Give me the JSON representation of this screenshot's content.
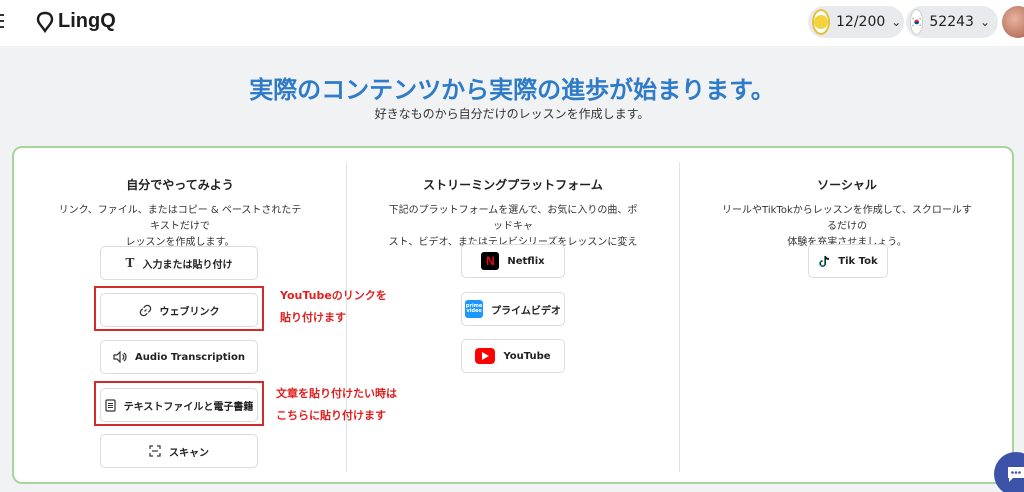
{
  "header": {
    "logo_text": "LingQ",
    "coins": "12/200",
    "streak": "52243"
  },
  "hero": {
    "title": "実際のコンテンツから実際の進歩が始まります。",
    "subtitle": "好きなものから自分だけのレッスンを作成します。"
  },
  "columns": [
    {
      "title": "自分でやってみよう",
      "description_line1": "リンク、ファイル、またはコピー & ペーストされたテキストだけで",
      "description_line2": "レッスンを作成します。",
      "buttons": [
        {
          "label": "入力または貼り付け",
          "icon": "text-icon"
        },
        {
          "label": "ウェブリンク",
          "icon": "link-icon"
        },
        {
          "label": "Audio Transcription",
          "icon": "speaker-icon"
        },
        {
          "label": "テキストファイルと電子書籍",
          "icon": "document-icon"
        },
        {
          "label": "スキャン",
          "icon": "scan-icon"
        }
      ]
    },
    {
      "title": "ストリーミングプラットフォーム",
      "description_line1": "下記のプラットフォームを選んで、お気に入りの曲、ポッドキャ",
      "description_line2": "スト、ビデオ、またはテレビシリーズをレッスンに変えましょう。",
      "buttons": [
        {
          "label": "Netflix",
          "icon": "netflix-icon"
        },
        {
          "label": "プライムビデオ",
          "icon": "prime-video-icon"
        },
        {
          "label": "YouTube",
          "icon": "youtube-icon"
        }
      ]
    },
    {
      "title": "ソーシャル",
      "description_line1": "リールやTikTokからレッスンを作成して、スクロールするだけの",
      "description_line2": "体験を充実させましょう。",
      "buttons": [
        {
          "label": "Tik Tok",
          "icon": "tiktok-icon"
        }
      ]
    }
  ],
  "annotations": {
    "weblink_note_line1": "YouTubeのリンクを",
    "weblink_note_line2": "貼り付けます",
    "textfile_note_line1": "文章を貼り付けたい時は",
    "textfile_note_line2": "こちらに貼り付けます"
  },
  "colors": {
    "accent": "#2e7bc8",
    "card_border": "#a6d59b",
    "annotation": "#e02020",
    "netflix": "#000000",
    "youtube": "#ff0000",
    "prime": "#1a98ff"
  }
}
